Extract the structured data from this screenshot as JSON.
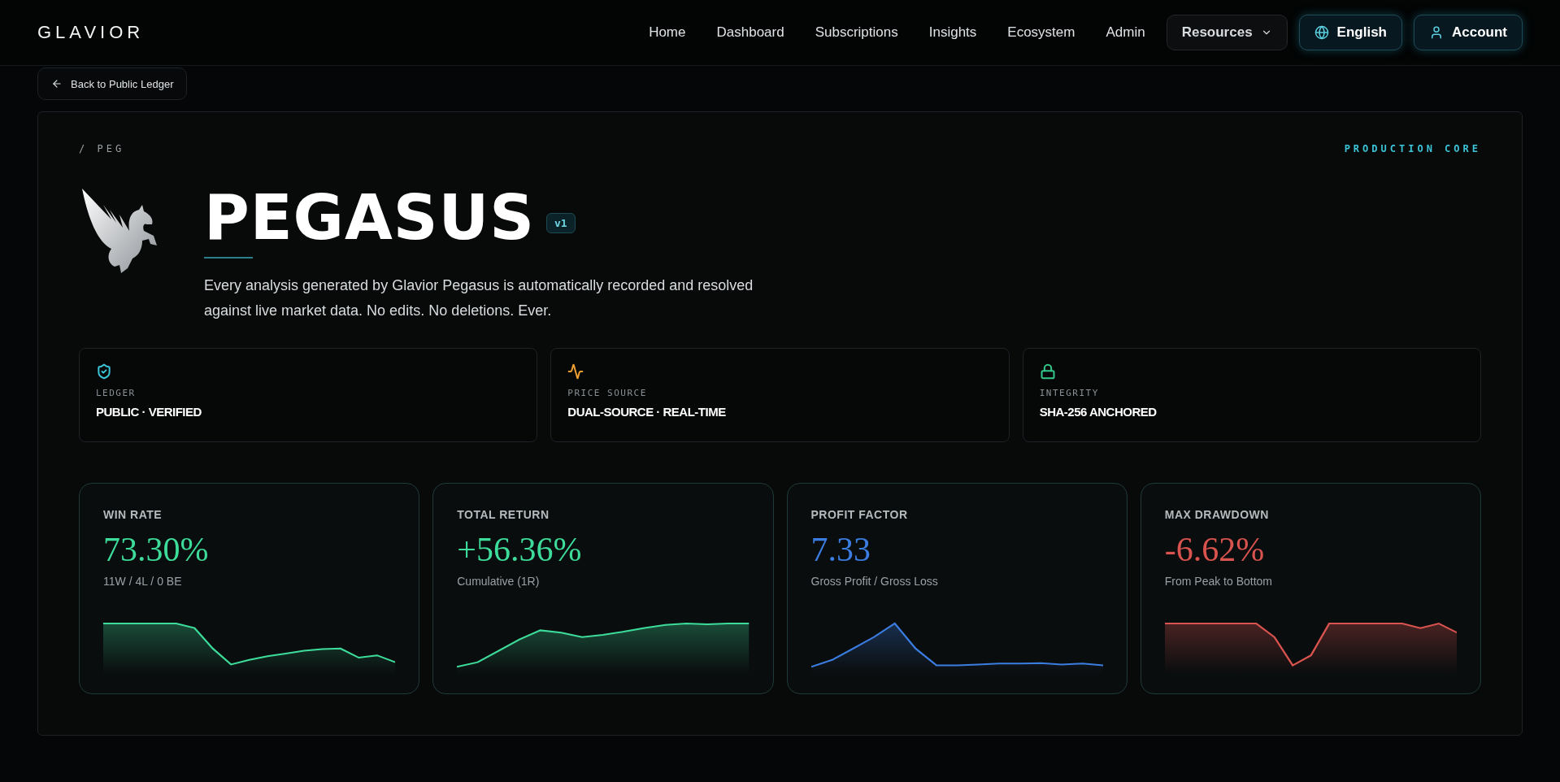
{
  "brand": "GLAVIOR",
  "nav": [
    {
      "label": "Home",
      "kind": "link"
    },
    {
      "label": "Dashboard",
      "kind": "link"
    },
    {
      "label": "Subscriptions",
      "kind": "link"
    },
    {
      "label": "Insights",
      "kind": "link"
    },
    {
      "label": "Ecosystem",
      "kind": "link"
    },
    {
      "label": "Admin",
      "kind": "link"
    },
    {
      "label": "Resources",
      "kind": "dropdown"
    },
    {
      "label": "English",
      "kind": "language"
    },
    {
      "label": "Account",
      "kind": "account"
    }
  ],
  "back_button": "Back to Public Ledger",
  "breadcrumb": "/ PEG",
  "tier": "PRODUCTION CORE",
  "title": "PEGASUS",
  "version": "v1",
  "description": "Every analysis generated by Glavior Pegasus is automatically recorded and resolved against live market data. No edits. No deletions. Ever.",
  "info_cards": [
    {
      "kind": "shield",
      "label": "LEDGER",
      "value": "PUBLIC · VERIFIED",
      "color": "#3cc4d8"
    },
    {
      "kind": "pulse",
      "label": "PRICE SOURCE",
      "value": "DUAL-SOURCE · REAL-TIME",
      "color": "#f0a030"
    },
    {
      "kind": "lock",
      "label": "INTEGRITY",
      "value": "SHA-256 ANCHORED",
      "color": "#34c98a"
    }
  ],
  "metrics": [
    {
      "label": "WIN RATE",
      "value": "73.30%",
      "sub": "11W / 4L / 0 BE",
      "color": "#3ddc9a"
    },
    {
      "label": "TOTAL RETURN",
      "value": "+56.36%",
      "sub": "Cumulative (1R)",
      "color": "#3ddc9a"
    },
    {
      "label": "PROFIT FACTOR",
      "value": "7.33",
      "sub": "Gross Profit / Gross Loss",
      "color": "#3b7de0"
    },
    {
      "label": "MAX DRAWDOWN",
      "value": "-6.62%",
      "sub": "From Peak to Bottom",
      "color": "#d9534f"
    }
  ]
}
